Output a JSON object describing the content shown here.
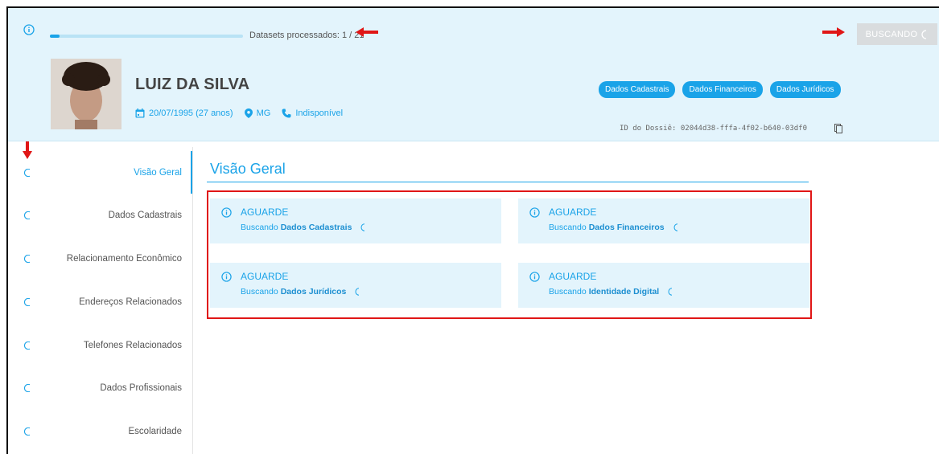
{
  "header": {
    "progress_text": "Datasets processados: 1 / 21",
    "progress_fraction": 0.048,
    "status_button": "BUSCANDO",
    "person_name": "LUIZ DA SILVA",
    "birth": "20/07/1995 (27 anos)",
    "state": "MG",
    "phone": "Indisponível",
    "pills": [
      "Dados Cadastrais",
      "Dados Financeiros",
      "Dados Jurídicos"
    ],
    "dossie_id": "ID do Dossiê: 02044d38-fffa-4f02-b640-03df0"
  },
  "sidebar": {
    "items": [
      {
        "label": "Visão Geral"
      },
      {
        "label": "Dados Cadastrais"
      },
      {
        "label": "Relacionamento Econômico"
      },
      {
        "label": "Endereços Relacionados"
      },
      {
        "label": "Telefones Relacionados"
      },
      {
        "label": "Dados Profissionais"
      },
      {
        "label": "Escolaridade"
      }
    ]
  },
  "main": {
    "title": "Visão Geral",
    "cards": [
      {
        "title": "AGUARDE",
        "prefix": "Buscando",
        "subject": "Dados Cadastrais"
      },
      {
        "title": "AGUARDE",
        "prefix": "Buscando",
        "subject": "Dados Financeiros"
      },
      {
        "title": "AGUARDE",
        "prefix": "Buscando",
        "subject": "Dados Jurídicos"
      },
      {
        "title": "AGUARDE",
        "prefix": "Buscando",
        "subject": "Identidade Digital"
      }
    ]
  },
  "colors": {
    "accent": "#1aa3e8",
    "header_bg": "#e3f4fc",
    "annotation_red": "#e01616"
  }
}
